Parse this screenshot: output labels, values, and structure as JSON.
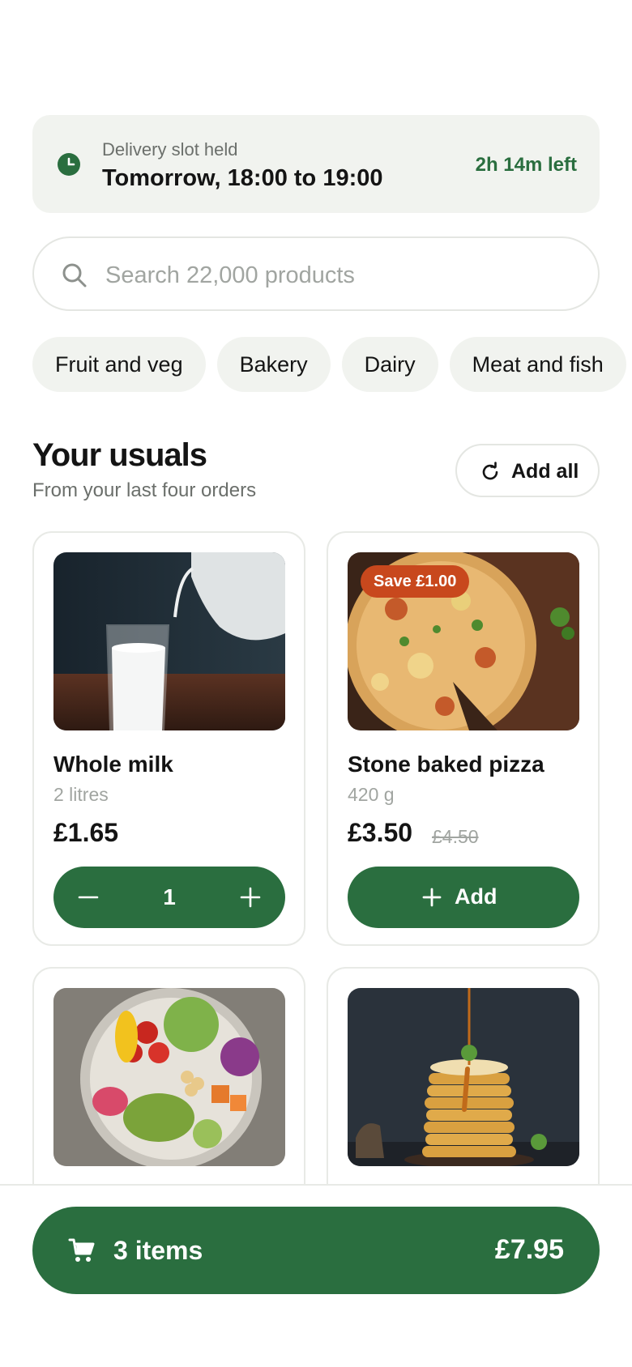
{
  "delivery": {
    "label": "Delivery slot held",
    "slot": "Tomorrow, 18:00 to 19:00",
    "time_left": "2h 14m left",
    "icon": "clock-icon"
  },
  "search": {
    "placeholder": "Search 22,000 products",
    "icon": "search-icon"
  },
  "categories": [
    "Fruit and veg",
    "Bakery",
    "Dairy",
    "Meat and fish"
  ],
  "usuals": {
    "title": "Your usuals",
    "subtitle": "From your last four orders",
    "add_all_label": "Add all"
  },
  "products": [
    {
      "name": "Whole milk",
      "size": "2 litres",
      "price": "£1.65",
      "quantity": "1"
    },
    {
      "name": "Stone baked pizza",
      "size": "420 g",
      "price": "£3.50",
      "was_price": "£4.50",
      "badge": "Save £1.00",
      "add_label": "Add"
    }
  ],
  "cart": {
    "items_label": "3 items",
    "total": "£7.95",
    "icon": "cart-icon"
  },
  "colors": {
    "accent": "#2a6e3f",
    "badge": "#c8481d",
    "chip_bg": "#f1f3ef"
  }
}
